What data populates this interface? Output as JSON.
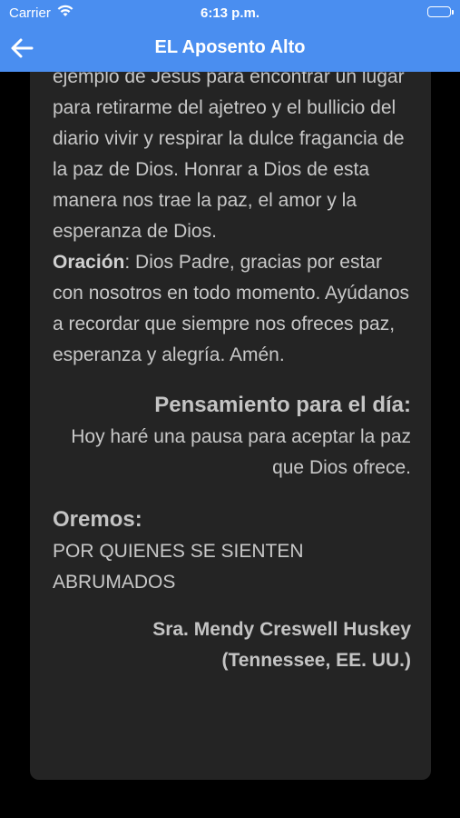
{
  "status": {
    "carrier": "Carrier",
    "time": "6:13 p.m."
  },
  "nav": {
    "title": "EL Aposento Alto",
    "back_icon": "arrow-left-icon"
  },
  "article": {
    "paragraph": "ejemplo de Jesús para encontrar un lugar para retirarme del ajetreo y el bullicio del diario vivir y respirar la dulce fragancia de la paz de Dios. Honrar a Dios de esta manera nos trae la paz, el amor y la esperanza de Dios.",
    "prayer_label": "Oración",
    "prayer_text": ": Dios Padre, gracias por estar con nosotros en todo momento. Ayúdanos a recordar que siempre nos ofreces paz, esperanza y alegría. Amén.",
    "thought_heading": "Pensamiento para el día:",
    "thought_text": "Hoy haré una pausa para aceptar la paz que Dios ofrece.",
    "pray_heading": "Oremos:",
    "pray_text": "POR QUIENES SE SIENTEN ABRUMADOS",
    "author_name": "Sra. Mendy Creswell Huskey",
    "author_location": "(Tennessee, EE. UU.)"
  },
  "colors": {
    "accent": "#4a8ef0",
    "card_bg": "#242424",
    "text": "#c8c8c8"
  }
}
